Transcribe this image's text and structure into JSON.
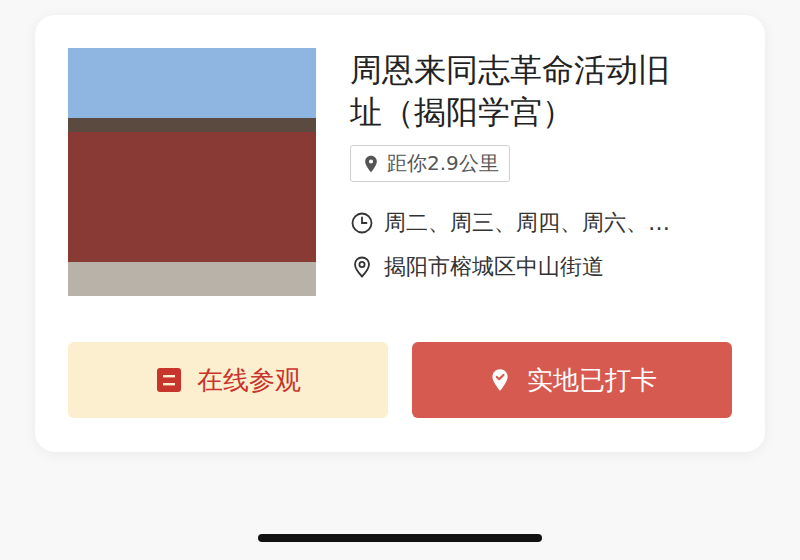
{
  "place": {
    "title": "周恩来同志革命活动旧址（揭阳学宫）",
    "distance": "距你2.9公里",
    "hours": "周二、周三、周四、周六、…",
    "address": "揭阳市榕城区中山街道"
  },
  "buttons": {
    "online": "在线参观",
    "checkin": "实地已打卡",
    "checked_in": true
  }
}
